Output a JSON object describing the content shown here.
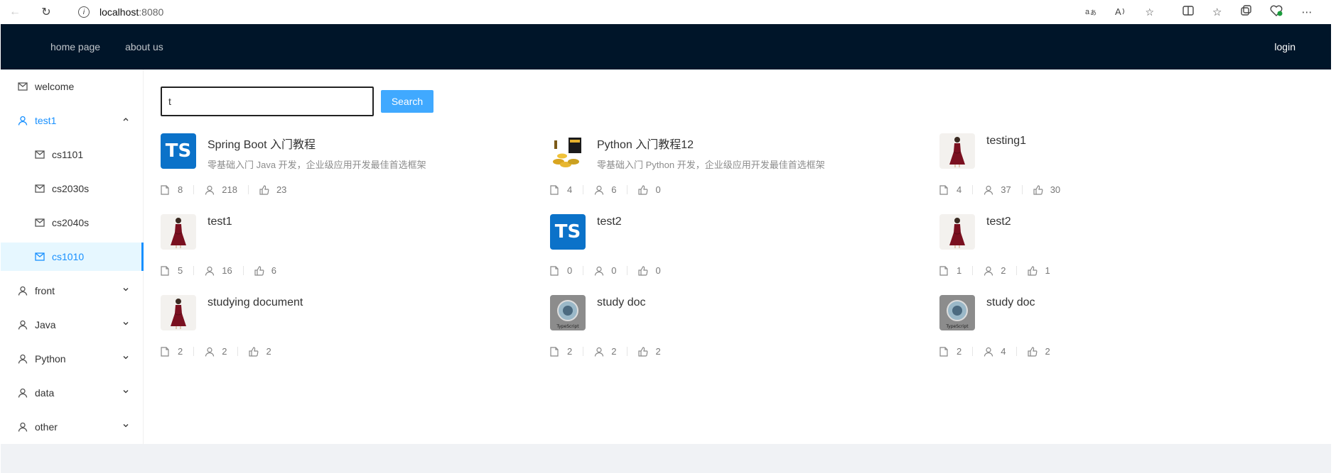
{
  "browser": {
    "url_host": "localhost",
    "url_port": ":8080"
  },
  "topbar": {
    "nav": [
      "home page",
      "about us"
    ],
    "login": "login"
  },
  "sidebar": {
    "welcome": "welcome",
    "group_test1": "test1",
    "sub_items": [
      "cs1101",
      "cs2030s",
      "cs2040s",
      "cs1010"
    ],
    "groups": [
      "front",
      "Java",
      "Python",
      "data",
      "other"
    ]
  },
  "search": {
    "value": "t",
    "button": "Search"
  },
  "cards": [
    {
      "title": "Spring Boot 入门教程",
      "desc": "零基础入门 Java 开发，企业级应用开发最佳首选框架",
      "docs": "8",
      "views": "218",
      "likes": "23",
      "avatar": "ts-icon"
    },
    {
      "title": "Python 入门教程12",
      "desc": "零基础入门 Python 开发，企业级应用开发最佳首选框架",
      "docs": "4",
      "views": "6",
      "likes": "0",
      "avatar": "coins-icon"
    },
    {
      "title": "testing1",
      "desc": "",
      "docs": "4",
      "views": "37",
      "likes": "30",
      "avatar": "dress-icon"
    },
    {
      "title": "test1",
      "desc": "",
      "docs": "5",
      "views": "16",
      "likes": "6",
      "avatar": "dress-icon"
    },
    {
      "title": "test2",
      "desc": "",
      "docs": "0",
      "views": "0",
      "likes": "0",
      "avatar": "ts-icon"
    },
    {
      "title": "test2",
      "desc": "",
      "docs": "1",
      "views": "2",
      "likes": "1",
      "avatar": "dress-icon"
    },
    {
      "title": "studying document",
      "desc": "",
      "docs": "2",
      "views": "2",
      "likes": "2",
      "avatar": "dress-icon"
    },
    {
      "title": "study doc",
      "desc": "",
      "docs": "2",
      "views": "2",
      "likes": "2",
      "avatar": "typescript-gear-icon"
    },
    {
      "title": "study doc",
      "desc": "",
      "docs": "2",
      "views": "4",
      "likes": "2",
      "avatar": "typescript-gear-icon"
    }
  ],
  "avatar_text": {
    "ts": "TS",
    "typescript": "TypeScript"
  },
  "colors": {
    "header": "#001529",
    "accent": "#1890ff",
    "button": "#40a9ff"
  }
}
